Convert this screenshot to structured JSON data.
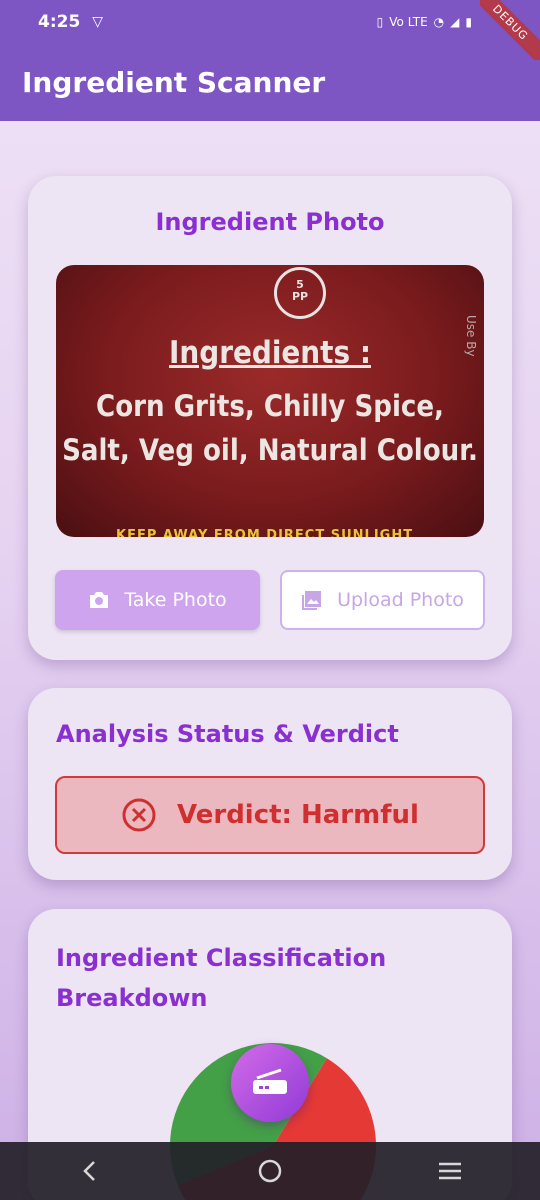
{
  "status_bar": {
    "time": "4:25",
    "vpn_icon": "vpn-icon",
    "indicators": "Vo LTE"
  },
  "debug_ribbon": "DEBUG",
  "app_bar": {
    "title": "Ingredient Scanner"
  },
  "photo_card": {
    "title": "Ingredient Photo",
    "photo_text": {
      "recycle_code": "5",
      "recycle_label": "PP",
      "heading": "Ingredients :",
      "line1": "Corn Grits, Chilly Spice,",
      "line2": "Salt, Veg oil, Natural Colour.",
      "bottom_strip": "KEEP AWAY FROM DIRECT SUNLIGHT",
      "side_text": "Use By"
    },
    "take_photo_label": "Take Photo",
    "upload_photo_label": "Upload Photo"
  },
  "analysis_card": {
    "title": "Analysis Status & Verdict",
    "verdict_text": "Verdict: Harmful",
    "verdict_color": "#d02f2f"
  },
  "classification_card": {
    "title": "Ingredient Classification Breakdown"
  },
  "chart_data": {
    "type": "pie",
    "slices": [
      {
        "color": "#e53935",
        "fraction": 0.6
      },
      {
        "color": "#43a047",
        "fraction": 0.4
      }
    ]
  },
  "fab_icon": "scanner-icon",
  "nav": {
    "back_icon": "back-icon",
    "home_icon": "home-icon",
    "recents_icon": "recents-icon"
  }
}
